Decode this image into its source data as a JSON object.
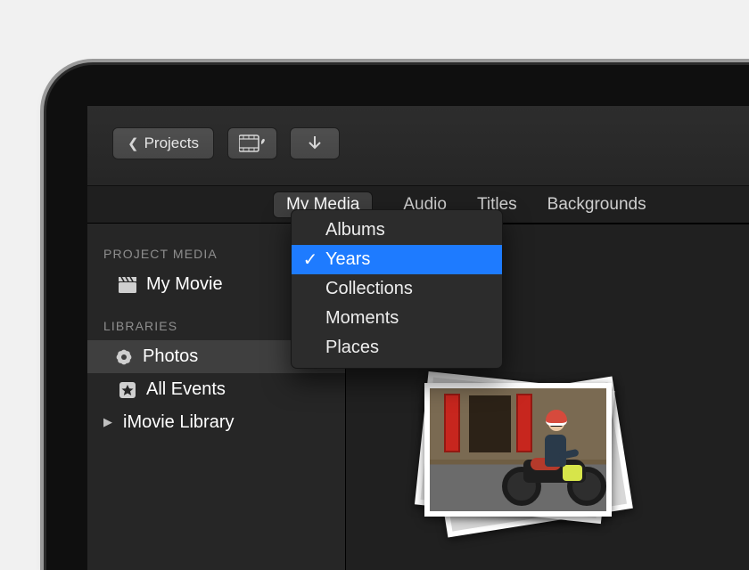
{
  "toolbar": {
    "back_label": "Projects"
  },
  "tabs": {
    "my_media": "My Media",
    "audio": "Audio",
    "titles": "Titles",
    "backgrounds": "Backgrounds"
  },
  "sidebar": {
    "project_media_label": "PROJECT MEDIA",
    "project_name": "My Movie",
    "libraries_label": "LIBRARIES",
    "photos": "Photos",
    "all_events": "All Events",
    "imovie_library": "iMovie Library"
  },
  "menu": {
    "items": [
      {
        "label": "Albums",
        "selected": false
      },
      {
        "label": "Years",
        "selected": true
      },
      {
        "label": "Collections",
        "selected": false
      },
      {
        "label": "Moments",
        "selected": false
      },
      {
        "label": "Places",
        "selected": false
      }
    ]
  }
}
